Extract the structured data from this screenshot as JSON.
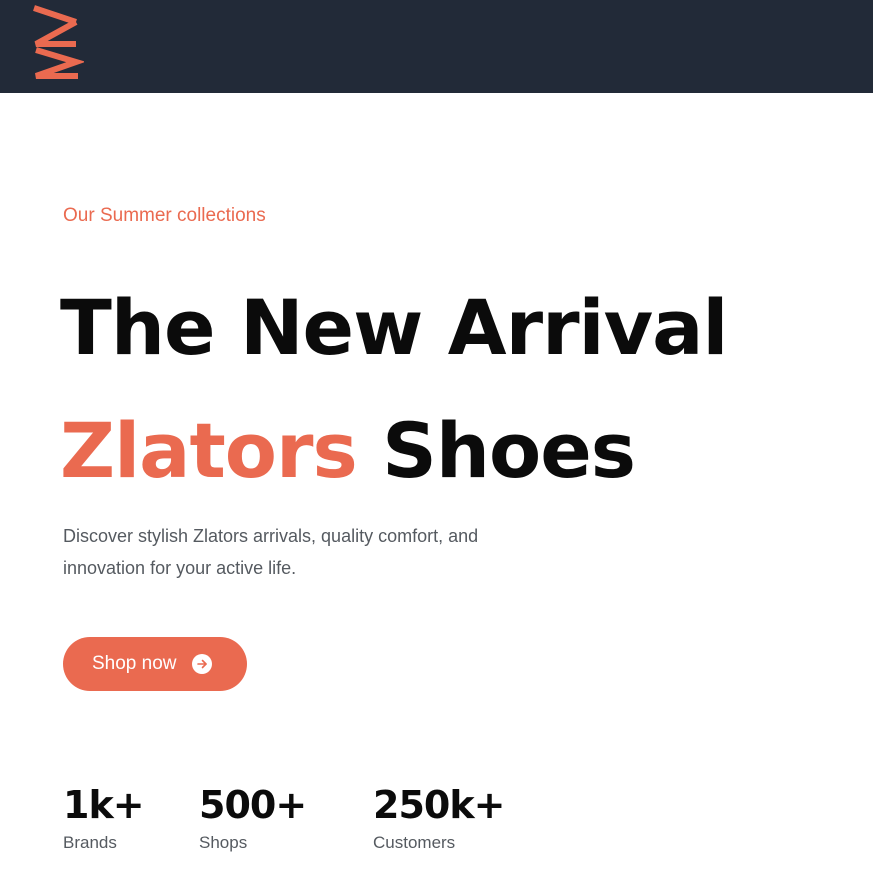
{
  "colors": {
    "accent": "#ea6a50",
    "header_bg": "#222a38",
    "heading": "#0b0b0b",
    "body_text": "#555a60"
  },
  "header": {
    "logo_icon": "zigzag-logo-icon"
  },
  "hero": {
    "eyebrow": "Our Summer collections",
    "headline_line1": "The New Arrival",
    "headline_accent": "Zlators",
    "headline_rest": " Shoes",
    "description": "Discover stylish Zlators arrivals, quality comfort, and innovation for your active life.",
    "cta": {
      "label": "Shop now",
      "icon": "arrow-right-circle-icon"
    }
  },
  "stats": [
    {
      "value": "1k+",
      "label": "Brands"
    },
    {
      "value": "500+",
      "label": "Shops"
    },
    {
      "value": "250k+",
      "label": "Customers"
    }
  ]
}
